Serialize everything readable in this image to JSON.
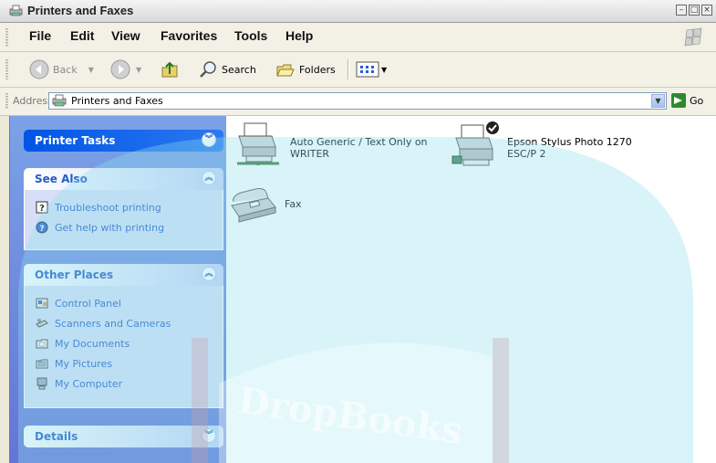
{
  "window": {
    "title": "Printers and Faxes"
  },
  "menu": [
    "File",
    "Edit",
    "View",
    "Favorites",
    "Tools",
    "Help"
  ],
  "toolbar": {
    "back": "Back",
    "search": "Search",
    "folders": "Folders"
  },
  "address": {
    "label": "Address",
    "value": "Printers and Faxes",
    "go": "Go"
  },
  "left_pane": {
    "printer_tasks": {
      "title": "Printer Tasks"
    },
    "see_also": {
      "title": "See Also",
      "items": [
        {
          "label": "Troubleshoot printing",
          "icon": "help-icon"
        },
        {
          "label": "Get help with printing",
          "icon": "help-globe-icon"
        }
      ]
    },
    "other_places": {
      "title": "Other Places",
      "items": [
        {
          "label": "Control Panel",
          "icon": "control-panel-icon"
        },
        {
          "label": "Scanners and Cameras",
          "icon": "scanner-icon"
        },
        {
          "label": "My Documents",
          "icon": "documents-folder-icon"
        },
        {
          "label": "My Pictures",
          "icon": "pictures-folder-icon"
        },
        {
          "label": "My Computer",
          "icon": "computer-icon"
        }
      ]
    },
    "details": {
      "title": "Details"
    }
  },
  "items": [
    {
      "name": "Auto Generic / Text Only on WRITER",
      "icon": "network-printer-icon"
    },
    {
      "name": "Epson Stylus Photo 1270 ESC/P 2",
      "icon": "default-printer-icon",
      "default": true
    },
    {
      "name": "Fax",
      "icon": "fax-icon"
    }
  ],
  "watermark": {
    "text": "DropBooks"
  },
  "colors": {
    "task_blue": "#215dc6",
    "pane_bg": "#6375d6",
    "watermark": "#7fd8e6"
  }
}
